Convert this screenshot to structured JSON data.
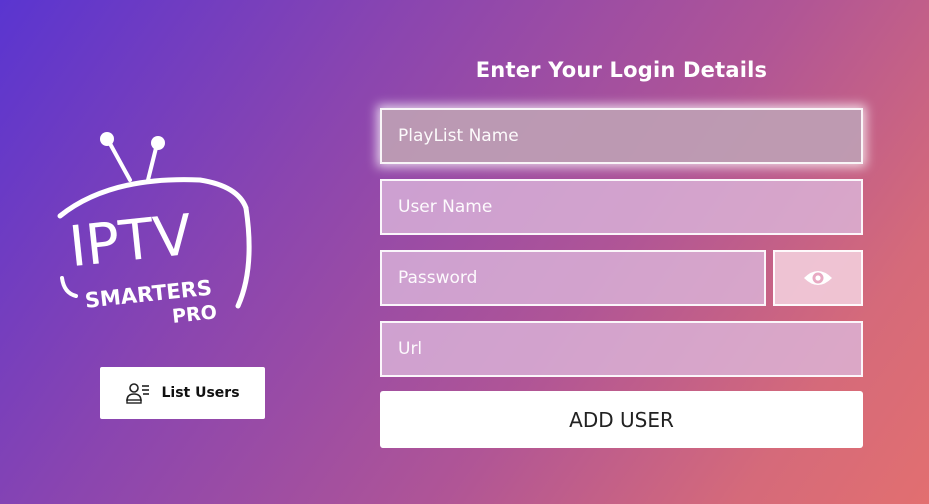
{
  "logo": {
    "line1": "IPTV",
    "line2": "SMARTERS",
    "line3": "PRO"
  },
  "list_users": {
    "label": "List Users",
    "icon": "users-list-icon"
  },
  "form": {
    "title": "Enter Your Login Details",
    "playlist_placeholder": "PlayList Name",
    "username_placeholder": "User Name",
    "password_placeholder": "Password",
    "url_placeholder": "Url",
    "show_password_icon": "eye-icon",
    "submit_label": "ADD USER"
  },
  "colors": {
    "gradient_start": "#5a35d0",
    "gradient_end": "#e26f70"
  }
}
